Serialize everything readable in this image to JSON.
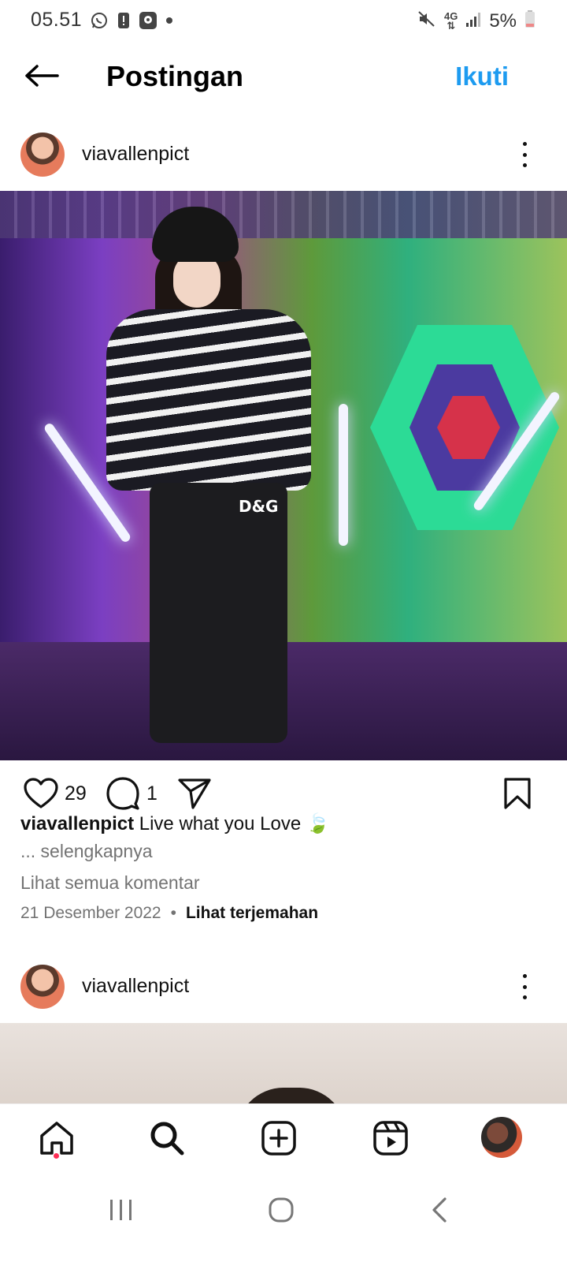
{
  "status_bar": {
    "time": "05.51",
    "battery": "5%",
    "network": "4G",
    "icons": [
      "whatsapp-icon",
      "alert-icon",
      "app-notification-icon",
      "dot-icon",
      "mute-icon",
      "4g-icon",
      "signal-icon",
      "battery-icon"
    ]
  },
  "header": {
    "title": "Postingan",
    "follow_label": "Ikuti",
    "back_icon": "arrow-left-icon"
  },
  "post": {
    "username": "viavallenpict",
    "likes": "29",
    "comments": "1",
    "caption_user": "viavallenpict",
    "caption_text": "Live what you Love 🍃",
    "more_label": "... selengkapnya",
    "view_comments_label": "Lihat semua komentar",
    "date": "21 Desember 2022",
    "separator": "•",
    "translate_label": "Lihat terjemahan",
    "image_text": "D&G"
  },
  "next_post": {
    "username": "viavallenpict"
  },
  "bottom_nav": {
    "items": [
      "home-icon",
      "search-icon",
      "create-icon",
      "reels-icon",
      "profile-avatar"
    ]
  },
  "system_nav": {
    "items": [
      "recent-apps-icon",
      "home-button-icon",
      "back-icon"
    ]
  },
  "colors": {
    "accent": "#1d9bf0",
    "secondary_text": "#737373",
    "notification_dot": "#ff2d55"
  }
}
